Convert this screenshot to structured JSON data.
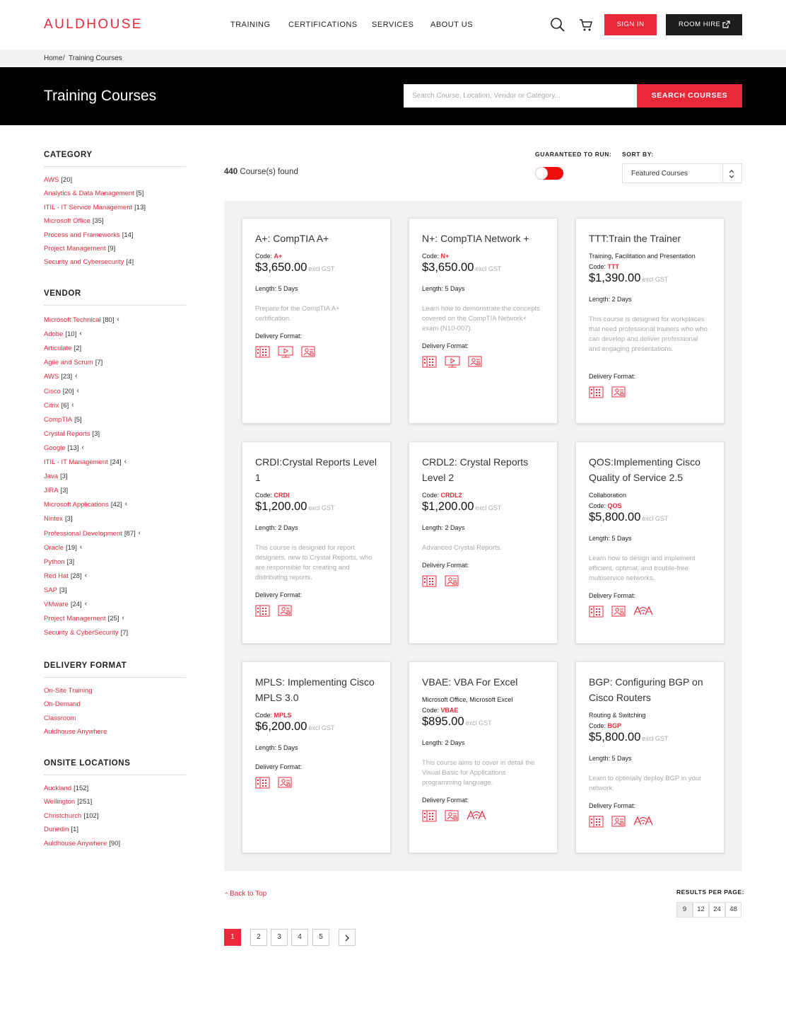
{
  "header": {
    "logo": "AULDHOUSE",
    "nav": [
      "TRAINING",
      "CERTIFICATIONS",
      "SERVICES",
      "ABOUT US"
    ],
    "sign_in": "SIGN IN",
    "room_hire": "ROOM HIRE"
  },
  "breadcrumb": {
    "home": "Home",
    "sep": " / ",
    "current": "Training Courses"
  },
  "hero": {
    "title": "Training Courses",
    "search_placeholder": "Search Course, Location, Vendor or Category...",
    "search_button": "SEARCH COURSES"
  },
  "sidebar": {
    "category": {
      "heading": "CATEGORY",
      "items": [
        {
          "label": "AWS",
          "count": "[20]"
        },
        {
          "label": "Analytics & Data Management",
          "count": "[5]"
        },
        {
          "label": "ITIL - IT Service Management",
          "count": "[13]"
        },
        {
          "label": "Microsoft Office",
          "count": "[35]"
        },
        {
          "label": "Process and Frameworks",
          "count": "[14]"
        },
        {
          "label": "Project Management",
          "count": "[9]"
        },
        {
          "label": "Security and Cybersecurity",
          "count": "[4]"
        }
      ]
    },
    "vendor": {
      "heading": "VENDOR",
      "items": [
        {
          "label": "Microsoft Technical",
          "count": "[80]",
          "chev": "‹"
        },
        {
          "label": "Adobe",
          "count": "[10]",
          "chev": "‹"
        },
        {
          "label": "Articulate",
          "count": "[2]",
          "chev": ""
        },
        {
          "label": "Agile and Scrum",
          "count": "[7]",
          "chev": ""
        },
        {
          "label": "AWS",
          "count": "[23]",
          "chev": "‹"
        },
        {
          "label": "Cisco",
          "count": "[20]",
          "chev": "‹"
        },
        {
          "label": "Citrix",
          "count": "[6]",
          "chev": "‹"
        },
        {
          "label": "CompTIA",
          "count": "[5]",
          "chev": ""
        },
        {
          "label": "Crystal Reports",
          "count": "[3]",
          "chev": ""
        },
        {
          "label": "Google",
          "count": "[13]",
          "chev": "‹"
        },
        {
          "label": "ITIL - IT Management",
          "count": "[24]",
          "chev": "‹"
        },
        {
          "label": "Java",
          "count": "[3]",
          "chev": ""
        },
        {
          "label": "JIRA",
          "count": "[3]",
          "chev": ""
        },
        {
          "label": "Microsoft Applications",
          "count": "[42]",
          "chev": "‹"
        },
        {
          "label": "Nintex",
          "count": "[3]",
          "chev": ""
        },
        {
          "label": "Professional Development",
          "count": "[87]",
          "chev": "‹"
        },
        {
          "label": "Oracle",
          "count": "[19]",
          "chev": "‹"
        },
        {
          "label": "Python",
          "count": "[3]",
          "chev": ""
        },
        {
          "label": "Red Hat",
          "count": "[28]",
          "chev": "‹"
        },
        {
          "label": "SAP",
          "count": "[3]",
          "chev": ""
        },
        {
          "label": "VMware",
          "count": "[24]",
          "chev": "‹"
        },
        {
          "label": "Project Management",
          "count": "[25]",
          "chev": "‹"
        },
        {
          "label": "Security & CyberSecurity",
          "count": "[7]",
          "chev": ""
        }
      ]
    },
    "delivery": {
      "heading": "DELIVERY FORMAT",
      "items": [
        {
          "label": "On-Site Training",
          "count": ""
        },
        {
          "label": "On-Demand",
          "count": ""
        },
        {
          "label": "Classroom",
          "count": ""
        },
        {
          "label": "Auldhouse Anywhere",
          "count": ""
        }
      ]
    },
    "locations": {
      "heading": "ONSITE LOCATIONS",
      "items": [
        {
          "label": "Auckland",
          "count": "[152]"
        },
        {
          "label": "Wellington",
          "count": "[251]"
        },
        {
          "label": "Christchurch",
          "count": "[102]"
        },
        {
          "label": "Dunedin",
          "count": "[1]"
        },
        {
          "label": "Auldhouse Anywhere",
          "count": "[90]"
        }
      ]
    }
  },
  "results": {
    "count": "440",
    "count_suffix": " Course(s) found",
    "guaranteed_label": "GUARANTEED TO RUN:",
    "guaranteed_on": true,
    "sort_label": "SORT BY:",
    "sort_value": "Featured Courses"
  },
  "labels": {
    "code": "Code: ",
    "excl_gst": "excl GST",
    "delivery_format": "Delivery Format:"
  },
  "courses": [
    {
      "title": "A+: CompTIA A+",
      "category": "",
      "code": "A+",
      "price": "$3,650.00",
      "length": "Length: 5 Days",
      "desc": "Prepare for the CompTIA A+ certification.",
      "formats": [
        "classroom-icon",
        "on-demand-icon",
        "onsite-icon"
      ]
    },
    {
      "title": "N+: CompTIA Network +",
      "category": "",
      "code": "N+",
      "price": "$3,650.00",
      "length": "Length: 5 Days",
      "desc": "Learn how to demonstrate the concepts covered on the CompTIA Network+ exam (N10-007).",
      "formats": [
        "classroom-icon",
        "on-demand-icon",
        "onsite-icon"
      ]
    },
    {
      "title": "TTT:Train the Trainer",
      "category": "Training, Facilitation and Presentation",
      "code": "TTT",
      "price": "$1,390.00",
      "length": "Length: 2 Days",
      "desc": "This course is designed for workplaces that need professional trainers who who can develop and deliver professional and engaging presentations.",
      "formats": [
        "classroom-icon",
        "onsite-icon"
      ]
    },
    {
      "title": "CRDI:Crystal Reports Level 1",
      "category": "",
      "code": "CRDI",
      "price": "$1,200.00",
      "length": "Length: 2 Days",
      "desc": "This course is designed for report designers, new to Crystal Reports, who are responsible for creating and distributing reports.",
      "formats": [
        "classroom-icon",
        "onsite-icon"
      ]
    },
    {
      "title": "CRDL2: Crystal Reports Level 2",
      "category": "",
      "code": "CRDL2",
      "price": "$1,200.00",
      "length": "Length: 2 Days",
      "desc": "Advanced Crystal Reports.",
      "formats": [
        "classroom-icon",
        "onsite-icon"
      ]
    },
    {
      "title": "QOS:Implementing Cisco Quality of Service 2.5",
      "category": "Collaboration",
      "code": "QOS",
      "price": "$5,800.00",
      "length": "Length: 5 Days",
      "desc": "Learn how to design and implement efficient, optimal, and trouble-free multiservice networks.",
      "formats": [
        "classroom-icon",
        "onsite-icon",
        "anywhere-icon"
      ]
    },
    {
      "title": "MPLS: Implementing Cisco MPLS 3.0",
      "category": "",
      "code": "MPLS",
      "price": "$6,200.00",
      "length": "Length: 5 Days",
      "desc": "",
      "formats": [
        "classroom-icon",
        "onsite-icon"
      ]
    },
    {
      "title": "VBAE: VBA For Excel",
      "category": "Microsoft Office, Microsoft Excel",
      "code": "VBAE",
      "price": "$895.00",
      "length": "Length: 2 Days",
      "desc": "This course aims to cover in detail the Visual Basic for Applications programming language.",
      "formats": [
        "classroom-icon",
        "onsite-icon",
        "anywhere-icon"
      ]
    },
    {
      "title": "BGP: Configuring BGP on Cisco Routers",
      "category": "Routing & Switching",
      "code": "BGP",
      "price": "$5,800.00",
      "length": "Length: 5 Days",
      "desc": "Learn to optimally deploy BGP in your network.",
      "formats": [
        "classroom-icon",
        "onsite-icon",
        "anywhere-icon"
      ]
    }
  ],
  "footer": {
    "back_to_top": "Back to Top",
    "rpp_label": "RESULTS PER PAGE:",
    "rpp_options": [
      "9",
      "12",
      "24",
      "48"
    ],
    "pages": [
      "1",
      "2",
      "3",
      "4",
      "5"
    ],
    "current_page": "1"
  },
  "colors": {
    "accent": "#e8293a",
    "dark": "#1d1d1d",
    "panel": "#f2f2f2"
  }
}
